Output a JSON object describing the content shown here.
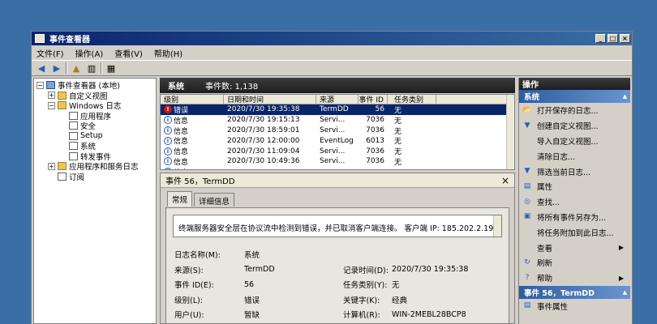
{
  "window": {
    "title": "事件查看器"
  },
  "menu": [
    "文件(F)",
    "操作(A)",
    "查看(V)",
    "帮助(H)"
  ],
  "toolbar": {
    "back_icon": "back-arrow-icon",
    "forward_icon": "forward-arrow-icon"
  },
  "tree": [
    {
      "label": "事件查看器 (本地)",
      "level": 0,
      "expander": "−",
      "icon": "root"
    },
    {
      "label": "自定义视图",
      "level": 1,
      "expander": "+",
      "icon": "folder"
    },
    {
      "label": "Windows 日志",
      "level": 1,
      "expander": "−",
      "icon": "folder"
    },
    {
      "label": "应用程序",
      "level": 2,
      "expander": "",
      "icon": "log"
    },
    {
      "label": "安全",
      "level": 2,
      "expander": "",
      "icon": "log"
    },
    {
      "label": "Setup",
      "level": 2,
      "expander": "",
      "icon": "log"
    },
    {
      "label": "系统",
      "level": 2,
      "expander": "",
      "icon": "log"
    },
    {
      "label": "转发事件",
      "level": 2,
      "expander": "",
      "icon": "log"
    },
    {
      "label": "应用程序和服务日志",
      "level": 1,
      "expander": "+",
      "icon": "folder"
    },
    {
      "label": "订阅",
      "level": 1,
      "expander": "",
      "icon": "log"
    }
  ],
  "center": {
    "log_name": "系统",
    "event_count": "事件数: 1,138",
    "columns": [
      "级别",
      "日期和时间",
      "来源",
      "事件 ID",
      "任务类别"
    ],
    "rows": [
      {
        "level": "错误",
        "type": "error",
        "datetime": "2020/7/30 19:35:38",
        "source": "TermDD",
        "id": "56",
        "task": "无"
      },
      {
        "level": "信息",
        "type": "info",
        "datetime": "2020/7/30 19:15:13",
        "source": "Servi...",
        "id": "7036",
        "task": "无"
      },
      {
        "level": "信息",
        "type": "info",
        "datetime": "2020/7/30 18:59:01",
        "source": "Servi...",
        "id": "7036",
        "task": "无"
      },
      {
        "level": "信息",
        "type": "info",
        "datetime": "2020/7/30 12:00:00",
        "source": "EventLog",
        "id": "6013",
        "task": "无"
      },
      {
        "level": "信息",
        "type": "info",
        "datetime": "2020/7/30 11:09:04",
        "source": "Servi...",
        "id": "7036",
        "task": "无"
      },
      {
        "level": "信息",
        "type": "info",
        "datetime": "2020/7/30 10:49:36",
        "source": "Servi...",
        "id": "7036",
        "task": "无"
      },
      {
        "level": "信息",
        "type": "info",
        "datetime": "",
        "source": "",
        "id": "",
        "task": ""
      }
    ]
  },
  "detail": {
    "title": "事件 56，TermDD",
    "tabs": [
      "常规",
      "详细信息"
    ],
    "message": "终端服务器安全层在协议流中检测到错误，并已取消客户端连接。 客户端 IP: 185.202.2.190。",
    "props": [
      {
        "l1": "日志名称(M):",
        "v1": "系统",
        "l2": "",
        "v2": ""
      },
      {
        "l1": "来源(S):",
        "v1": "TermDD",
        "l2": "记录时间(D):",
        "v2": "2020/7/30 19:35:38"
      },
      {
        "l1": "事件 ID(E):",
        "v1": "56",
        "l2": "任务类别(Y):",
        "v2": "无"
      },
      {
        "l1": "级别(L):",
        "v1": "错误",
        "l2": "关键字(K):",
        "v2": "经典"
      },
      {
        "l1": "用户(U):",
        "v1": "暂缺",
        "l2": "计算机(R):",
        "v2": "WIN-2MEBL28BCP8"
      }
    ]
  },
  "actions": {
    "header": "操作",
    "section1": "系统",
    "items1": [
      {
        "label": "打开保存的日志...",
        "icon": "open-log-icon",
        "glyph": "📂",
        "sub": false
      },
      {
        "label": "创建自定义视图...",
        "icon": "filter-icon",
        "glyph": "▼",
        "sub": false
      },
      {
        "label": "导入自定义视图...",
        "icon": "",
        "glyph": "",
        "sub": false
      },
      {
        "label": "清除日志...",
        "icon": "",
        "glyph": "",
        "sub": false
      },
      {
        "label": "筛选当前日志...",
        "icon": "filter-icon",
        "glyph": "▼",
        "sub": false
      },
      {
        "label": "属性",
        "icon": "properties-icon",
        "glyph": "▤",
        "sub": false
      },
      {
        "label": "查找...",
        "icon": "binoculars-icon",
        "glyph": "◎",
        "sub": false
      },
      {
        "label": "将所有事件另存为...",
        "icon": "save-icon",
        "glyph": "▣",
        "sub": false
      },
      {
        "label": "将任务附加到此日志...",
        "icon": "",
        "glyph": "",
        "sub": false
      },
      {
        "label": "查看",
        "icon": "",
        "glyph": "",
        "sub": true
      },
      {
        "label": "刷新",
        "icon": "refresh-icon",
        "glyph": "↻",
        "sub": false
      },
      {
        "label": "帮助",
        "icon": "help-icon",
        "glyph": "?",
        "sub": true
      }
    ],
    "section2": "事件 56，TermDD",
    "items2": [
      {
        "label": "事件属性",
        "icon": "properties-icon",
        "glyph": "▤",
        "sub": false
      }
    ]
  }
}
